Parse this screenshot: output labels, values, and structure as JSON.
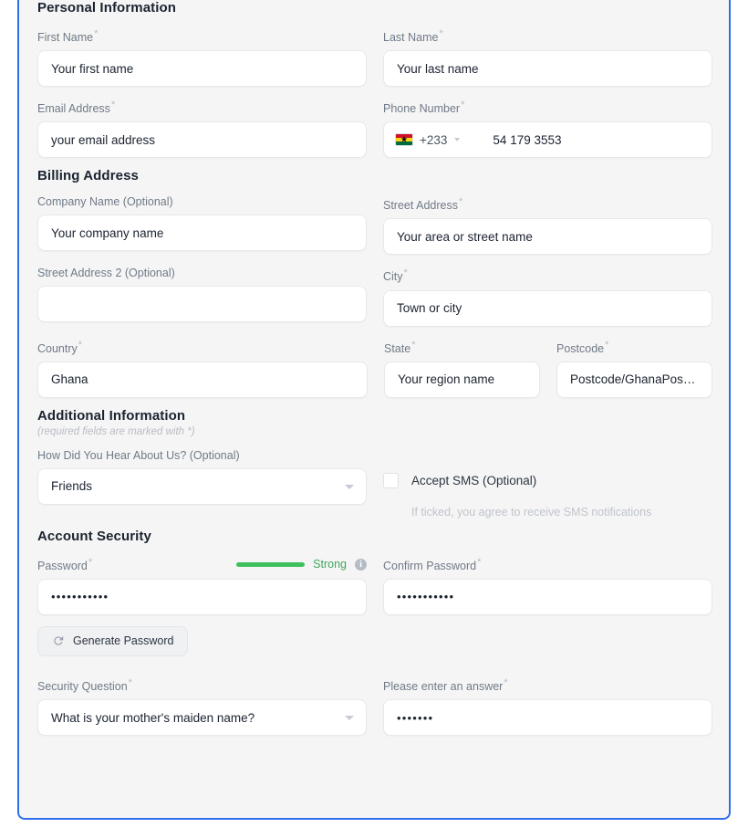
{
  "theme": {
    "accent": "#2f6fed",
    "panel_bg": "#f5f5f5",
    "strength_green": "#3ec15c"
  },
  "personal": {
    "title": "Personal Information",
    "first_name": {
      "label": "First Name",
      "required": "*",
      "value": "Your first name"
    },
    "last_name": {
      "label": "Last Name",
      "required": "*",
      "value": "Your last name"
    },
    "email": {
      "label": "Email Address",
      "required": "*",
      "value": "your email address"
    },
    "phone": {
      "label": "Phone Number",
      "required": "*",
      "country_flag": "ghana-flag-icon",
      "dial_code": "+233",
      "value": "54 179 3553"
    }
  },
  "billing": {
    "title": "Billing Address",
    "company": {
      "label": "Company Name (Optional)",
      "value": "Your company name"
    },
    "street": {
      "label": "Street Address",
      "required": "*",
      "value": "Your area or street name"
    },
    "street2": {
      "label": "Street Address 2 (Optional)",
      "value": ""
    },
    "city": {
      "label": "City",
      "required": "*",
      "value": "Town or city"
    },
    "country": {
      "label": "Country",
      "required": "*",
      "value": "Ghana"
    },
    "state": {
      "label": "State",
      "required": "*",
      "value": "Your region name"
    },
    "postcode": {
      "label": "Postcode",
      "required": "*",
      "value": "Postcode/GhanaPostGp"
    }
  },
  "additional": {
    "title": "Additional Information",
    "note": "(required fields are marked with *)",
    "hear_about": {
      "label": "How Did You Hear About Us? (Optional)",
      "value": "Friends"
    },
    "accept_sms": {
      "label": "Accept SMS (Optional)",
      "checked": false,
      "help": "If ticked, you agree to receive SMS notifications"
    }
  },
  "security": {
    "title": "Account Security",
    "password": {
      "label": "Password",
      "required": "*",
      "value": "•••••••••••",
      "strength_label": "Strong",
      "strength_percent": 100
    },
    "confirm_password": {
      "label": "Confirm Password",
      "required": "*",
      "value": "•••••••••••"
    },
    "generate_button": {
      "label": "Generate Password",
      "icon": "refresh-icon"
    },
    "security_question": {
      "label": "Security Question",
      "required": "*",
      "value": "What is your mother's maiden name?"
    },
    "security_answer": {
      "label": "Please enter an answer",
      "required": "*",
      "value": "•••••••"
    }
  }
}
